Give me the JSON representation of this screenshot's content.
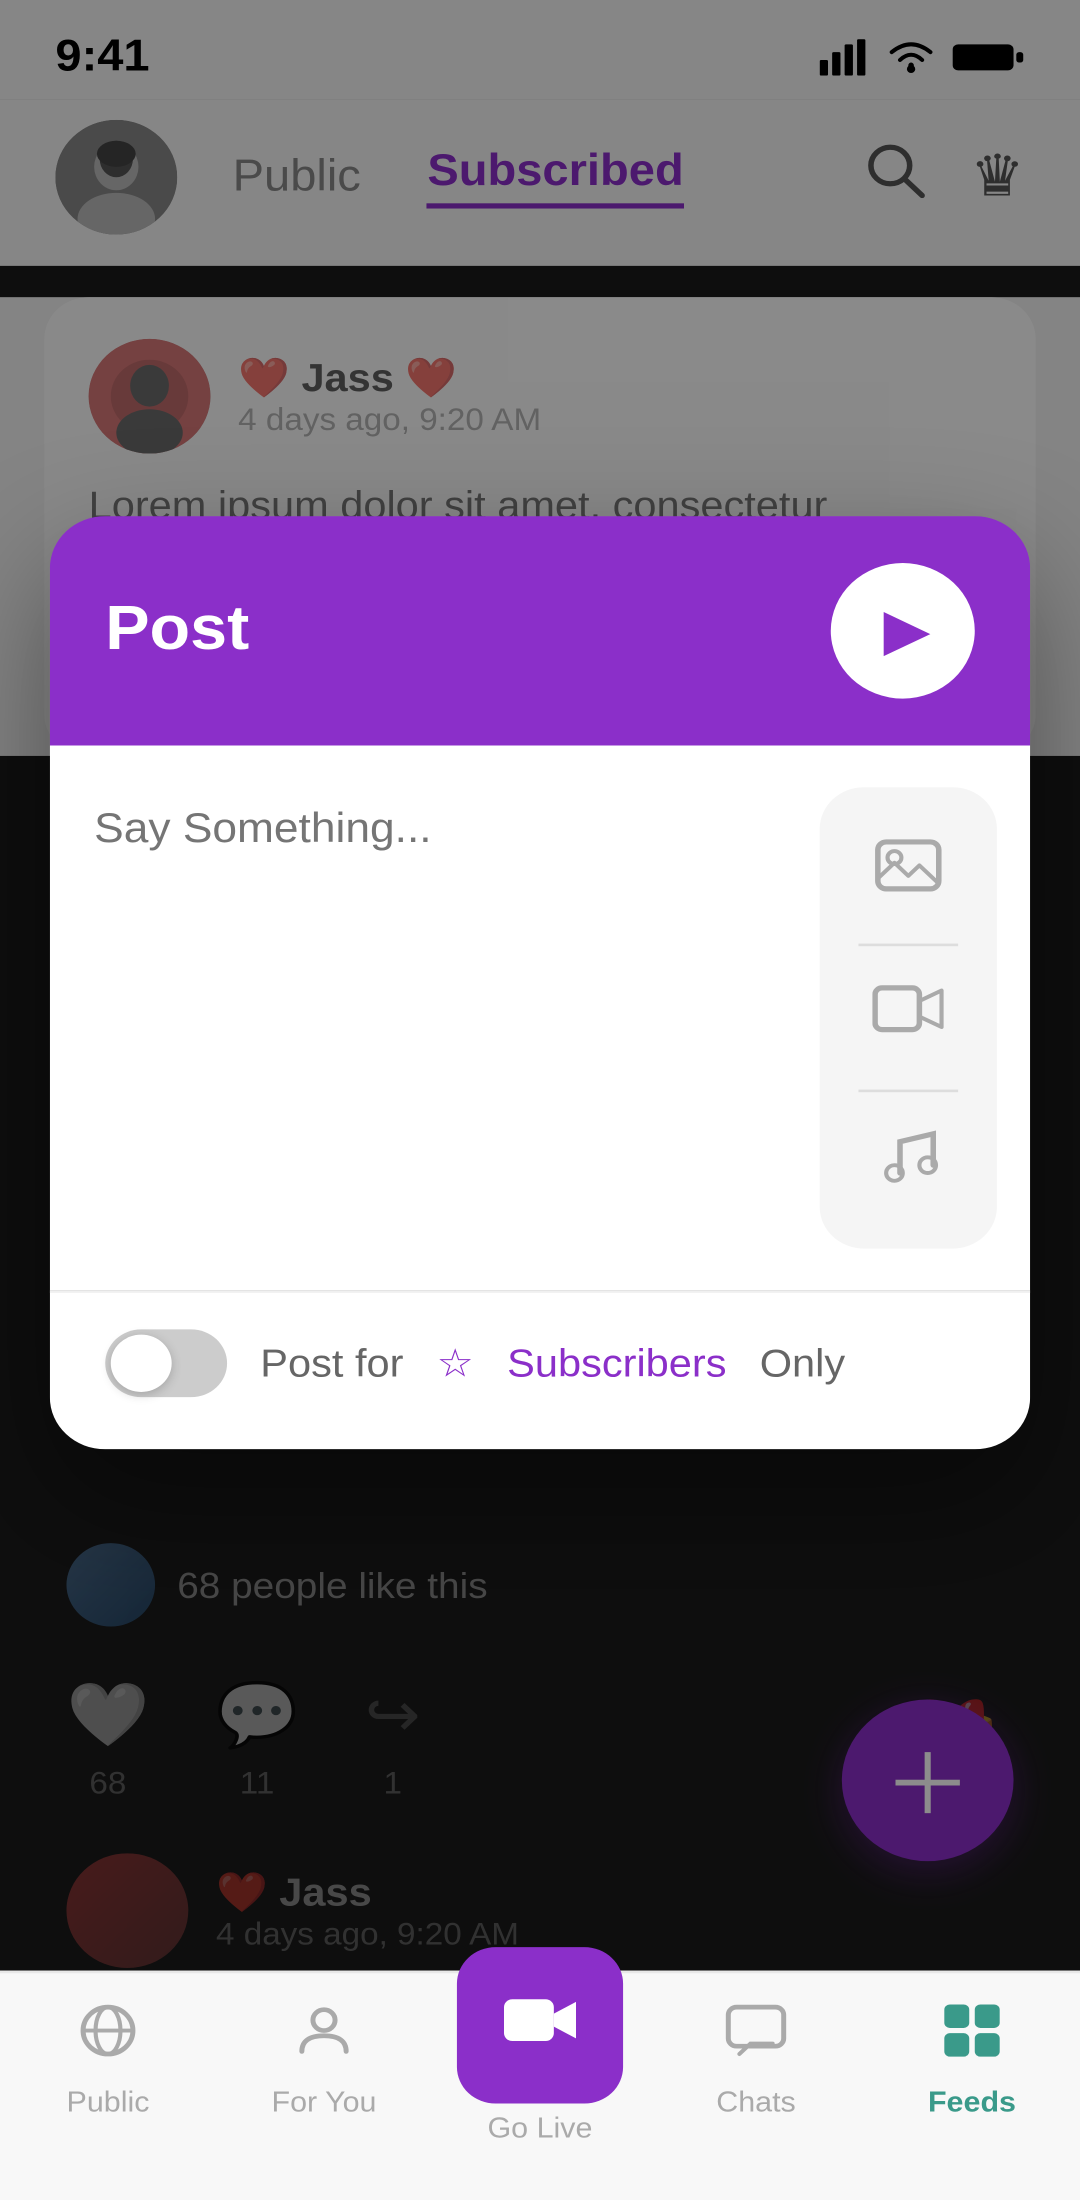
{
  "statusBar": {
    "time": "9:41",
    "signal": "●●●●",
    "wifi": "wifi",
    "battery": "battery"
  },
  "header": {
    "tabPublic": "Public",
    "tabSubscribed": "Subscribed"
  },
  "backgroundPost": {
    "authorName": "Jass ❤️",
    "heartEmoji": "❤️",
    "authorTime": "4 days ago, 9:20 AM",
    "text": "Lorem ipsum dolor sit amet, consectetur adipisicing elit, sed do eiusmod tempor incididunt  quis nostrud exercitation ullamco laboris nisi ut 🤍🤍🤍"
  },
  "postModal": {
    "title": "Post",
    "sendButtonLabel": "▶",
    "textareaPlaceholder": "Say Something...",
    "postForLabel": "Post for",
    "subscribersLabel": "Subscribers",
    "onlyLabel": "Only"
  },
  "reactions": {
    "likesText": "68 people like this"
  },
  "actions": {
    "likeCount": "68",
    "commentCount": "11",
    "shareCount": "1"
  },
  "secondPost": {
    "authorName": "Jass",
    "heartEmoji": "❤️",
    "authorTime": "4 days ago, 9:20 AM"
  },
  "bottomNav": {
    "items": [
      {
        "label": "Public",
        "icon": "◎",
        "active": false
      },
      {
        "label": "For You",
        "icon": "👤",
        "active": false
      },
      {
        "label": "Go Live",
        "icon": "📹",
        "active": false,
        "special": true
      },
      {
        "label": "Chats",
        "icon": "💬",
        "active": false
      },
      {
        "label": "Feeds",
        "icon": "📋",
        "active": true
      }
    ]
  }
}
